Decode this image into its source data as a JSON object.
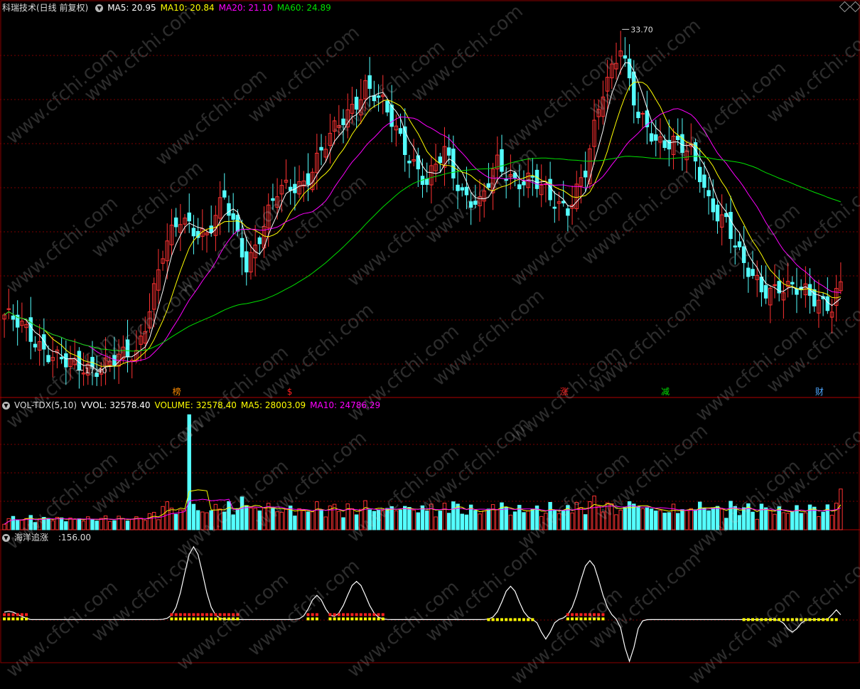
{
  "header": {
    "title": "科瑞技术(日线 前复权)",
    "ma_items": [
      {
        "label": "MA5: 20.95",
        "color": "#ffffff"
      },
      {
        "label": "MA10: 20.84",
        "color": "#ffff00"
      },
      {
        "label": "MA20: 21.10",
        "color": "#ff00ff"
      },
      {
        "label": "MA60: 24.89",
        "color": "#00e000"
      }
    ]
  },
  "volume_header": {
    "name": "VOL-TDX(5,10)",
    "items": [
      {
        "label": "VVOL: 32578.40",
        "color": "#ffffff"
      },
      {
        "label": "VOLUME: 32578.40",
        "color": "#ffff00"
      },
      {
        "label": "MA5: 28003.09",
        "color": "#ffff00"
      },
      {
        "label": "MA10: 24786.29",
        "color": "#ff00ff"
      }
    ]
  },
  "indicator_header": {
    "name": "海洋追涨",
    "value": ":156.00"
  },
  "watermark": "www.cfchi.com",
  "colors": {
    "up": "#ff3232",
    "down": "#54ffff",
    "grid": "#7a0000",
    "ma5": "#ffffff",
    "ma10": "#ffff00",
    "ma20": "#ff00ff",
    "ma60": "#00e000"
  },
  "signals": [
    {
      "label": "榜",
      "color": "#ff8c00",
      "day": 2
    },
    {
      "label": "$",
      "color": "#ff2020",
      "day": 3
    },
    {
      "label": "涨",
      "color": "#ff2020",
      "day": 4
    },
    {
      "label": "减",
      "color": "#00e000",
      "day": 5
    },
    {
      "label": "财",
      "color": "#4fa8ff",
      "day": 6
    }
  ],
  "chart_data": [
    {
      "type": "candlestick",
      "title": "科瑞技术(日线 前复权)",
      "ylim": [
        16.5,
        34.5
      ],
      "annotations": [
        {
          "label": "33.70",
          "value": 33.7,
          "kind": "high"
        },
        {
          "label": "17.40",
          "value": 17.4,
          "kind": "low"
        }
      ],
      "series": [
        {
          "name": "MA5",
          "values": []
        },
        {
          "name": "MA10",
          "values": []
        },
        {
          "name": "MA20",
          "values": []
        },
        {
          "name": "MA60",
          "values": []
        }
      ],
      "anchors": [
        [
          0,
          20.0
        ],
        [
          14,
          17.6
        ],
        [
          16,
          17.4
        ],
        [
          26,
          17.8
        ],
        [
          30,
          18.1
        ],
        [
          36,
          23.0
        ],
        [
          40,
          24.5
        ],
        [
          46,
          24.0
        ],
        [
          50,
          25.5
        ],
        [
          55,
          22.5
        ],
        [
          62,
          25.8
        ],
        [
          68,
          26.5
        ],
        [
          72,
          27.8
        ],
        [
          78,
          29.8
        ],
        [
          82,
          31.1
        ],
        [
          86,
          30.0
        ],
        [
          90,
          28.6
        ],
        [
          96,
          26.2
        ],
        [
          100,
          27.9
        ],
        [
          104,
          26.0
        ],
        [
          108,
          25.2
        ],
        [
          112,
          27.3
        ],
        [
          116,
          26.6
        ],
        [
          120,
          26.4
        ],
        [
          124,
          25.6
        ],
        [
          128,
          25.3
        ],
        [
          132,
          26.8
        ],
        [
          136,
          30.8
        ],
        [
          140,
          33.2
        ],
        [
          144,
          29.4
        ],
        [
          148,
          28.3
        ],
        [
          152,
          28.6
        ],
        [
          156,
          27.7
        ],
        [
          160,
          25.4
        ],
        [
          164,
          24.7
        ],
        [
          168,
          22.2
        ],
        [
          172,
          21.2
        ],
        [
          176,
          21.5
        ],
        [
          180,
          21.1
        ],
        [
          184,
          20.8
        ],
        [
          188,
          20.6
        ],
        [
          190,
          21.6
        ]
      ]
    },
    {
      "type": "bar",
      "title": "VOL-TDX(5,10)",
      "ylim": [
        0,
        95000
      ],
      "series": [
        {
          "name": "VOLUME",
          "values": []
        },
        {
          "name": "MA5",
          "values": []
        },
        {
          "name": "MA10",
          "values": []
        }
      ],
      "last_value": 32578.4
    },
    {
      "type": "line",
      "title": "海洋追涨",
      "ylim": [
        -60,
        110
      ],
      "last_value": 156.0,
      "peaks": [
        {
          "center": 43,
          "width": 3,
          "height": 105
        },
        {
          "center": 71,
          "width": 2.2,
          "height": 35
        },
        {
          "center": 80,
          "width": 3,
          "height": 55
        },
        {
          "center": 115,
          "width": 2.5,
          "height": 48
        },
        {
          "center": 133,
          "width": 3.2,
          "height": 85
        },
        {
          "center": 142,
          "width": 1.6,
          "height": -60
        },
        {
          "center": 123,
          "width": 1.5,
          "height": -28
        },
        {
          "center": 179,
          "width": 1.8,
          "height": -18
        },
        {
          "center": 189,
          "width": 1.2,
          "height": 14
        }
      ]
    }
  ]
}
